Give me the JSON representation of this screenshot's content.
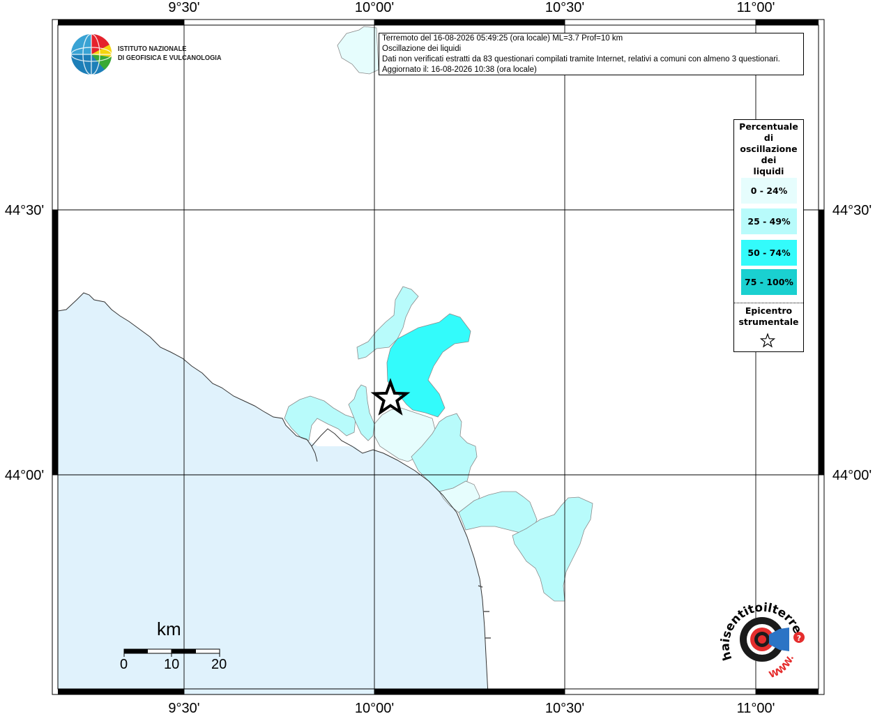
{
  "map": {
    "lon_labels": [
      "9°30'",
      "10°00'",
      "10°30'",
      "11°00'"
    ],
    "lat_labels": [
      "44°30'",
      "44°00'"
    ],
    "lon_range": [
      "9°10'",
      "11°10'"
    ],
    "lat_range": [
      "43°43'",
      "44°40'"
    ],
    "sea_color": "#e0f2fc",
    "land_color": "#ffffff",
    "epicenter": "star"
  },
  "info": {
    "line1": "Terremoto del 16-08-2026 05:49:25 (ora locale) ML=3.7 Prof=10 km",
    "line2": "Oscillazione dei liquidi",
    "line3": "Dati non verificati estratti da 83 questionari compilati tramite Internet, relativi a comuni con almeno 3 questionari.",
    "line4": "Aggiornato il: 16-08-2026 10:38 (ora locale)"
  },
  "logo": {
    "line1": "ISTITUTO NAZIONALE",
    "line2": "DI GEOFISICA E VULCANOLOGIA",
    "haisentito_text": "haisentitoilterremoto.it",
    "www_text": "WWW."
  },
  "legend": {
    "title_lines": [
      "Percentuale",
      "di",
      "oscillazione",
      "dei",
      "liquidi"
    ],
    "items": [
      {
        "label": "0 - 24%",
        "color": "#e6fdfd"
      },
      {
        "label": "25 - 49%",
        "color": "#b8fbfb"
      },
      {
        "label": "50 - 74%",
        "color": "#33fbfb"
      },
      {
        "label": "75 - 100%",
        "color": "#1ad0d0"
      }
    ],
    "epicenter_lines": [
      "Epicentro",
      "strumentale"
    ]
  },
  "scalebar": {
    "title": "km",
    "labels": [
      "0",
      "10",
      "20"
    ]
  }
}
